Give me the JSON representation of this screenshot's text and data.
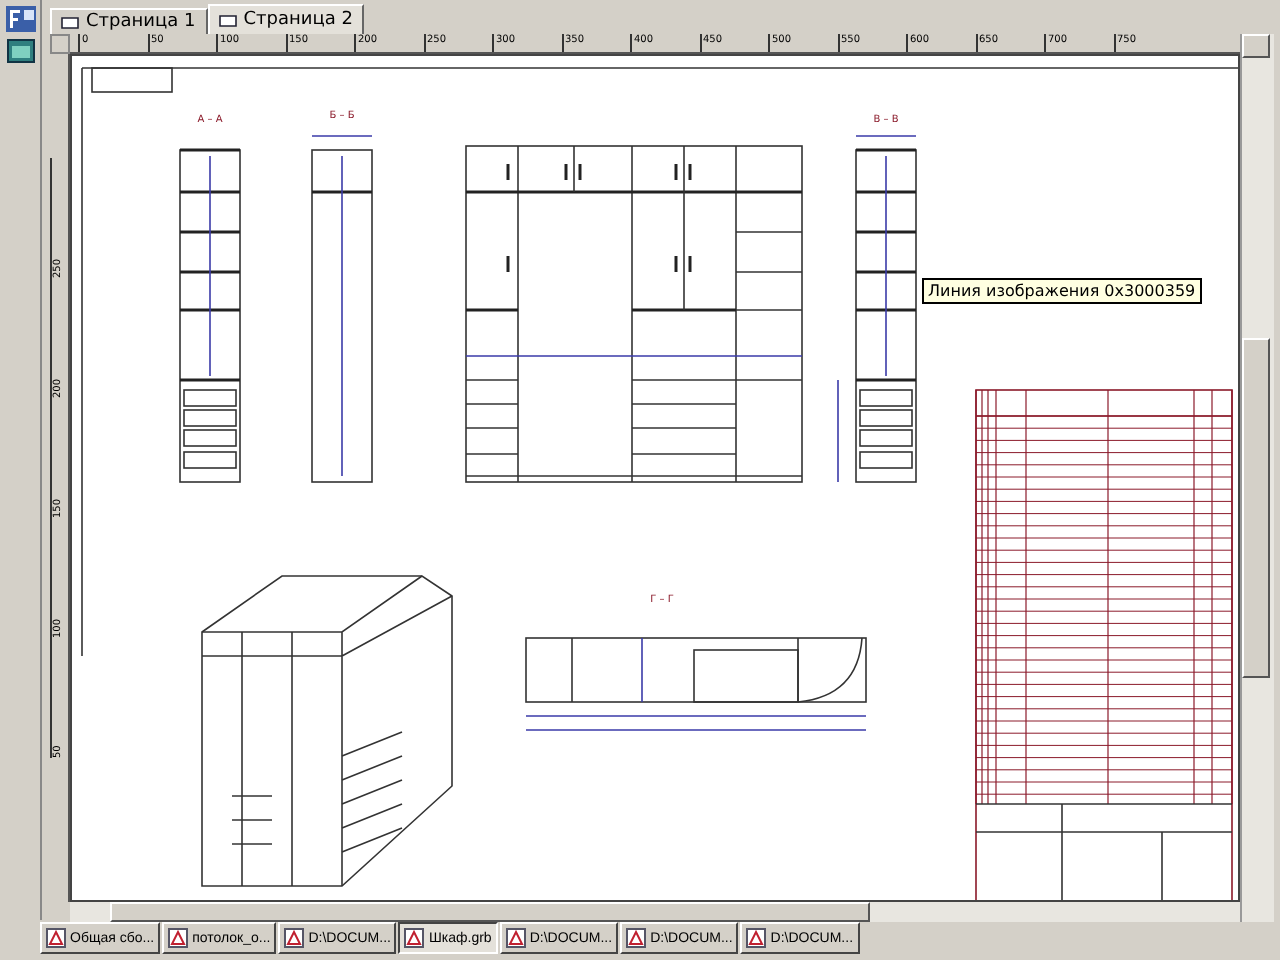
{
  "tabs": [
    {
      "label": "Страница 1",
      "selected": false
    },
    {
      "label": "Страница 2",
      "selected": true
    }
  ],
  "ruler": {
    "h_ticks": [
      "0",
      "50",
      "100",
      "150",
      "200",
      "250",
      "300",
      "350",
      "400",
      "450",
      "500",
      "550",
      "600",
      "650",
      "700",
      "750"
    ],
    "v_ticks": [
      "250",
      "200",
      "150",
      "100",
      "50"
    ]
  },
  "drawing": {
    "view_labels": [
      "А – А",
      "Б – Б",
      "В – В",
      "Г – Г"
    ],
    "tooltip": "Линия изображения 0x3000359"
  },
  "taskbar": [
    {
      "label": "Общая сбо...",
      "selected": false
    },
    {
      "label": "потолок_о...",
      "selected": false
    },
    {
      "label": "D:\\DOCUM...",
      "selected": false
    },
    {
      "label": "Шкаф.grb",
      "selected": true
    },
    {
      "label": "D:\\DOCUM...",
      "selected": false
    },
    {
      "label": "D:\\DOCUM...",
      "selected": false
    },
    {
      "label": "D:\\DOCUM...",
      "selected": false
    }
  ]
}
